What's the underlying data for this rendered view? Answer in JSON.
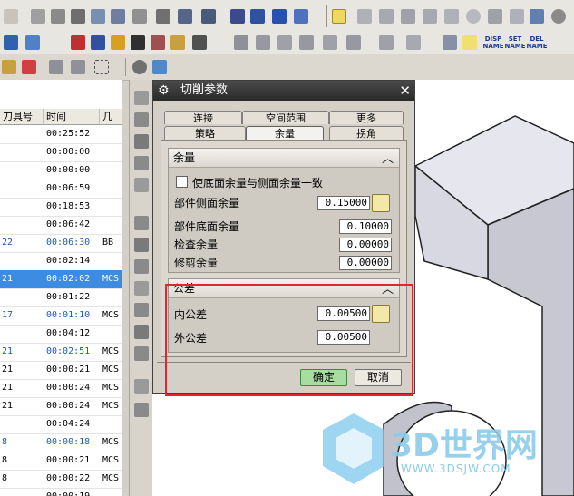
{
  "toolbar": {
    "nav_labels": [
      "DISP NAME",
      "SET NAME",
      "DEL NAME"
    ]
  },
  "navigator": {
    "columns": [
      "刀具号",
      "时间",
      "几"
    ],
    "rows": [
      {
        "tool": "",
        "time": "00:25:52",
        "geo": "",
        "selected": false,
        "blue": false
      },
      {
        "tool": "",
        "time": "00:00:00",
        "geo": "",
        "selected": false,
        "blue": false
      },
      {
        "tool": "",
        "time": "00:00:00",
        "geo": "",
        "selected": false,
        "blue": false
      },
      {
        "tool": "",
        "time": "00:06:59",
        "geo": "",
        "selected": false,
        "blue": false
      },
      {
        "tool": "",
        "time": "00:18:53",
        "geo": "",
        "selected": false,
        "blue": false
      },
      {
        "tool": "",
        "time": "00:06:42",
        "geo": "",
        "selected": false,
        "blue": false
      },
      {
        "tool": "22",
        "time": "00:06:30",
        "geo": "BB",
        "selected": false,
        "blue": true
      },
      {
        "tool": "",
        "time": "00:02:14",
        "geo": "",
        "selected": false,
        "blue": false
      },
      {
        "tool": "21",
        "time": "00:02:02",
        "geo": "MCS",
        "selected": true,
        "blue": false
      },
      {
        "tool": "",
        "time": "00:01:22",
        "geo": "",
        "selected": false,
        "blue": false
      },
      {
        "tool": "17",
        "time": "00:01:10",
        "geo": "MCS",
        "selected": false,
        "blue": true
      },
      {
        "tool": "",
        "time": "00:04:12",
        "geo": "",
        "selected": false,
        "blue": false
      },
      {
        "tool": "21",
        "time": "00:02:51",
        "geo": "MCS",
        "selected": false,
        "blue": true
      },
      {
        "tool": "21",
        "time": "00:00:21",
        "geo": "MCS",
        "selected": false,
        "blue": false
      },
      {
        "tool": "21",
        "time": "00:00:24",
        "geo": "MCS",
        "selected": false,
        "blue": false
      },
      {
        "tool": "21",
        "time": "00:00:24",
        "geo": "MCS",
        "selected": false,
        "blue": false
      },
      {
        "tool": "",
        "time": "00:04:24",
        "geo": "",
        "selected": false,
        "blue": false
      },
      {
        "tool": "8",
        "time": "00:00:18",
        "geo": "MCS",
        "selected": false,
        "blue": true
      },
      {
        "tool": "8",
        "time": "00:00:21",
        "geo": "MCS",
        "selected": false,
        "blue": false
      },
      {
        "tool": "8",
        "time": "00:00:22",
        "geo": "MCS",
        "selected": false,
        "blue": false
      },
      {
        "tool": "",
        "time": "00:00:19",
        "geo": "",
        "selected": false,
        "blue": false
      }
    ]
  },
  "dialog": {
    "title": "切削参数",
    "tabs_top": [
      "连接",
      "空间范围",
      "更多"
    ],
    "tabs_bottom": [
      "策略",
      "余量",
      "拐角"
    ],
    "active_tab": "余量",
    "stock_group": {
      "title": "余量",
      "checkbox_label": "使底面余量与侧面余量一致",
      "part_side_label": "部件侧面余量",
      "part_side_value": "0.15000",
      "part_floor_label": "部件底面余量",
      "part_floor_value": "0.10000",
      "check_label": "检查余量",
      "check_value": "0.00000",
      "trim_label": "修剪余量",
      "trim_value": "0.00000"
    },
    "tolerance_group": {
      "title": "公差",
      "intol_label": "内公差",
      "intol_value": "0.00500",
      "outtol_label": "外公差",
      "outtol_value": "0.00500"
    },
    "ok_label": "确定",
    "cancel_label": "取消"
  },
  "watermark": {
    "brand": "3D世界网",
    "url": "WWW.3DSJW.COM"
  },
  "colors": {
    "highlight_box": "#e0262e",
    "selection": "#3c8ce4",
    "ok_button": "#a8dca0"
  }
}
